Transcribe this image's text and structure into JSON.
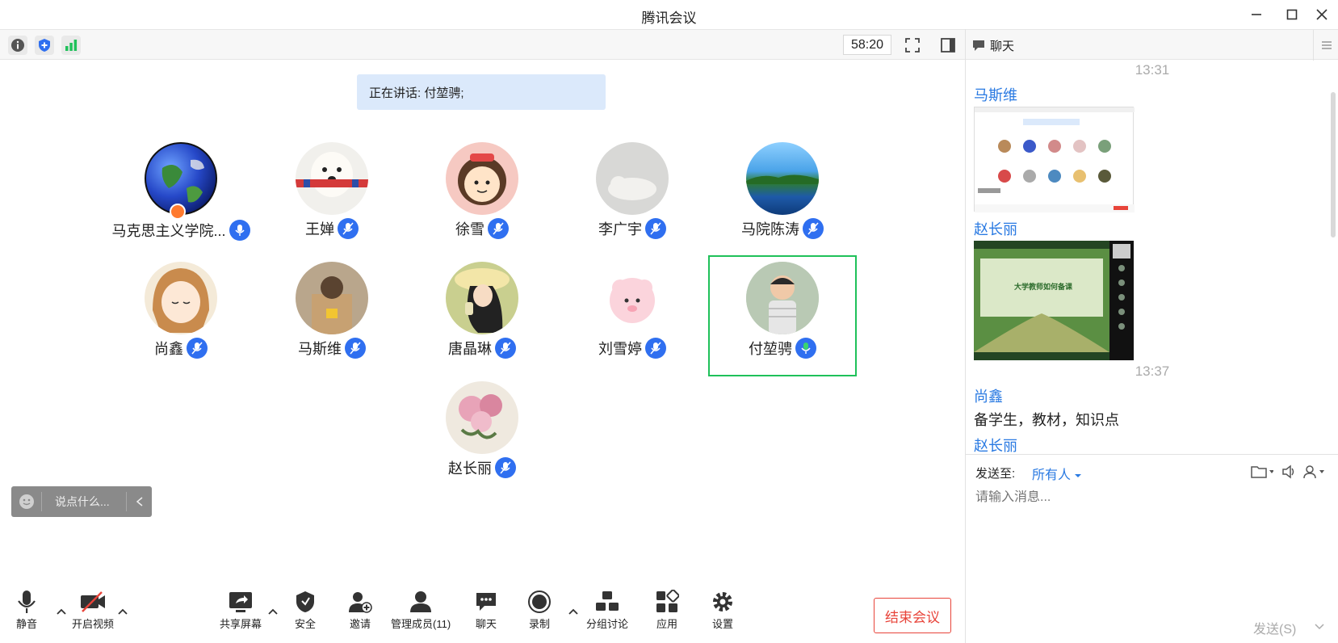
{
  "window": {
    "title": "腾讯会议"
  },
  "toolbar": {
    "timer": "58:20"
  },
  "stage": {
    "speaking_label": "正在讲话: 付堃骋;",
    "participants": [
      {
        "name": "马克思主义学院...",
        "avatar": "earth",
        "host": true
      },
      {
        "name": "王婵",
        "avatar": "dog"
      },
      {
        "name": "徐雪",
        "avatar": "girl-cartoon"
      },
      {
        "name": "李广宇",
        "avatar": "cat"
      },
      {
        "name": "马院陈涛",
        "avatar": "lake"
      },
      {
        "name": "尚鑫",
        "avatar": "anime-girl"
      },
      {
        "name": "马斯维",
        "avatar": "box-toy"
      },
      {
        "name": "唐晶琳",
        "avatar": "hat-girl"
      },
      {
        "name": "刘雪婷",
        "avatar": "pink-sheep"
      },
      {
        "name": "付堃骋",
        "avatar": "child",
        "active": true
      },
      {
        "name": "赵长丽",
        "avatar": "peony"
      }
    ],
    "say_placeholder": "说点什么..."
  },
  "bottombar": {
    "mute": "静音",
    "video": "开启视频",
    "share": "共享屏幕",
    "security": "安全",
    "invite": "邀请",
    "members": "管理成员(11)",
    "chat": "聊天",
    "record": "录制",
    "breakout": "分组讨论",
    "apps": "应用",
    "settings": "设置",
    "end": "结束会议"
  },
  "chat": {
    "title": "聊天",
    "messages": [
      {
        "time": "13:31"
      },
      {
        "sender": "马斯维",
        "image": "meeting-screenshot"
      },
      {
        "sender": "赵长丽",
        "image": "slide-screenshot"
      },
      {
        "time": "13:37"
      },
      {
        "sender": "尚鑫",
        "text": "备学生，教材，知识点"
      },
      {
        "sender": "赵长丽"
      }
    ],
    "slide_caption": "大学教师如何备课",
    "send_to_label": "发送至:",
    "send_to_target": "所有人",
    "input_placeholder": "请输入消息...",
    "send_button": "发送(S)"
  },
  "colors": {
    "accent": "#2a7ae2",
    "active_border": "#1fc15a",
    "end_red": "#e8443a"
  }
}
